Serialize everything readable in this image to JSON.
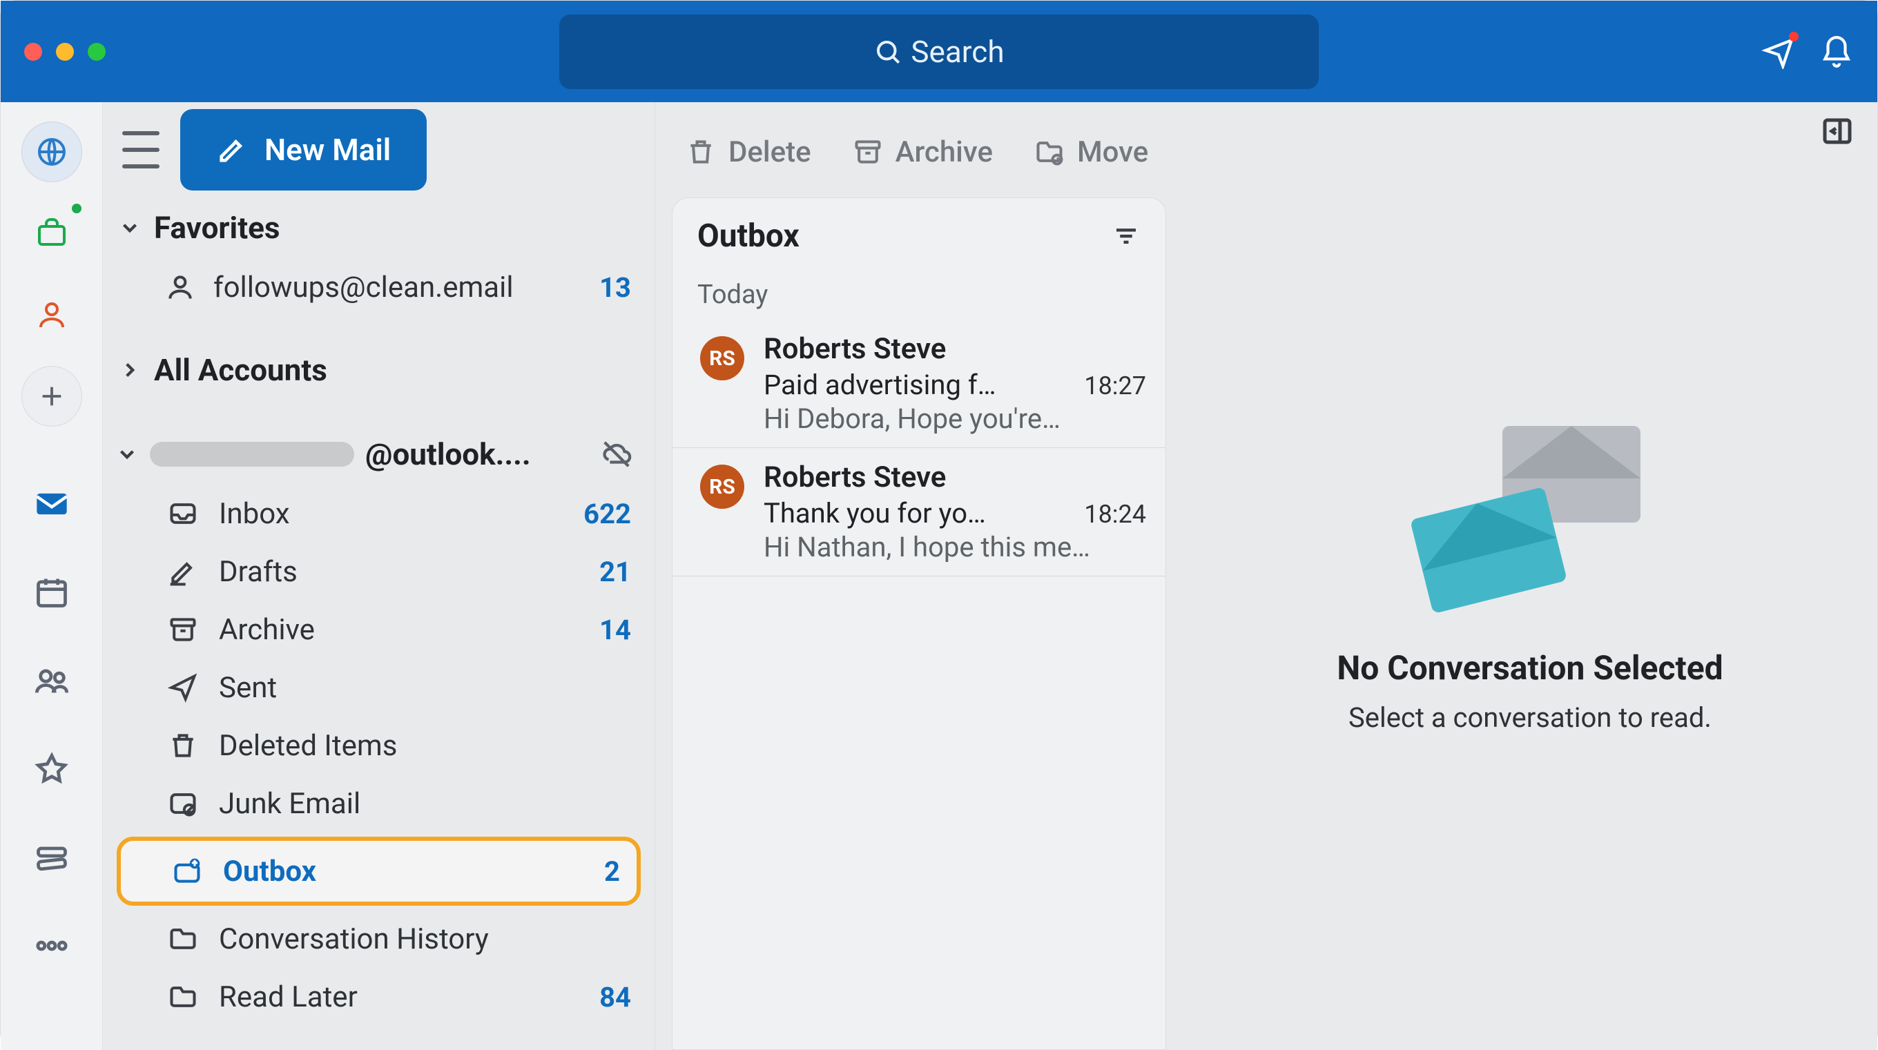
{
  "titlebar": {
    "search_placeholder": "Search"
  },
  "toolbar": {
    "new_mail": "New Mail"
  },
  "sidebar": {
    "favorites_label": "Favorites",
    "favorite": {
      "email": "followups@clean.email",
      "count": "13"
    },
    "all_accounts_label": "All Accounts",
    "account_suffix": "@outlook....",
    "folders": {
      "inbox": {
        "label": "Inbox",
        "count": "622"
      },
      "drafts": {
        "label": "Drafts",
        "count": "21"
      },
      "archive": {
        "label": "Archive",
        "count": "14"
      },
      "sent": {
        "label": "Sent",
        "count": ""
      },
      "deleted": {
        "label": "Deleted Items",
        "count": ""
      },
      "junk": {
        "label": "Junk Email",
        "count": ""
      },
      "outbox": {
        "label": "Outbox",
        "count": "2"
      },
      "conv": {
        "label": "Conversation History",
        "count": ""
      },
      "read": {
        "label": "Read Later",
        "count": "84"
      }
    }
  },
  "actions": {
    "delete": "Delete",
    "archive": "Archive",
    "move": "Move"
  },
  "list": {
    "title": "Outbox",
    "group": "Today",
    "msgs": [
      {
        "initials": "RS",
        "from": "Roberts Steve",
        "subject": "Paid advertising f…",
        "time": "18:27",
        "preview": "Hi Debora, Hope you're…"
      },
      {
        "initials": "RS",
        "from": "Roberts Steve",
        "subject": "Thank you for yo…",
        "time": "18:24",
        "preview": "Hi Nathan, I hope this me…"
      }
    ]
  },
  "reading": {
    "title": "No Conversation Selected",
    "sub": "Select a conversation to read."
  }
}
